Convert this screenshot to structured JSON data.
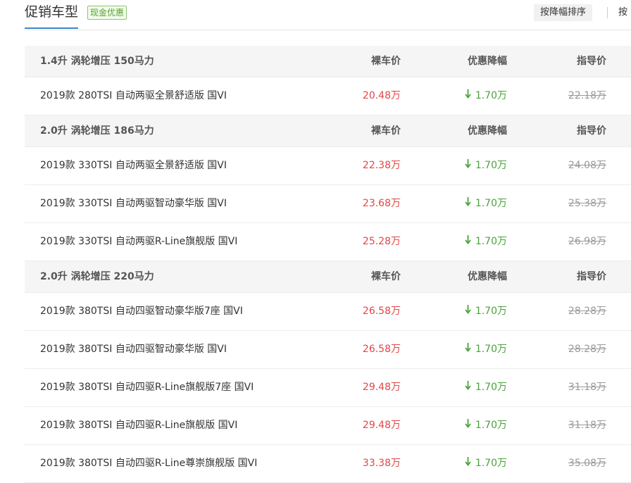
{
  "header": {
    "title": "促销车型",
    "badge": "现金优惠",
    "sort_discount": "按降幅排序",
    "sort_other": "按"
  },
  "columns": {
    "price": "裸车价",
    "discount": "优惠降幅",
    "guide": "指导价"
  },
  "groups": [
    {
      "engine": "1.4升 涡轮增压 150马力",
      "models": [
        {
          "name": "2019款 280TSI 自动两驱全景舒适版 国VI",
          "price": "20.48万",
          "discount": "1.70万",
          "guide": "22.18万"
        }
      ]
    },
    {
      "engine": "2.0升 涡轮增压 186马力",
      "models": [
        {
          "name": "2019款 330TSI 自动两驱全景舒适版 国VI",
          "price": "22.38万",
          "discount": "1.70万",
          "guide": "24.08万"
        },
        {
          "name": "2019款 330TSI 自动两驱智动豪华版 国VI",
          "price": "23.68万",
          "discount": "1.70万",
          "guide": "25.38万"
        },
        {
          "name": "2019款 330TSI 自动两驱R-Line旗舰版 国VI",
          "price": "25.28万",
          "discount": "1.70万",
          "guide": "26.98万"
        }
      ]
    },
    {
      "engine": "2.0升 涡轮增压 220马力",
      "models": [
        {
          "name": "2019款 380TSI 自动四驱智动豪华版7座 国VI",
          "price": "26.58万",
          "discount": "1.70万",
          "guide": "28.28万"
        },
        {
          "name": "2019款 380TSI 自动四驱智动豪华版 国VI",
          "price": "26.58万",
          "discount": "1.70万",
          "guide": "28.28万"
        },
        {
          "name": "2019款 380TSI 自动四驱R-Line旗舰版7座 国VI",
          "price": "29.48万",
          "discount": "1.70万",
          "guide": "31.18万"
        },
        {
          "name": "2019款 380TSI 自动四驱R-Line旗舰版 国VI",
          "price": "29.48万",
          "discount": "1.70万",
          "guide": "31.18万"
        },
        {
          "name": "2019款 380TSI 自动四驱R-Line尊崇旗舰版 国VI",
          "price": "33.38万",
          "discount": "1.70万",
          "guide": "35.08万"
        }
      ]
    }
  ],
  "colors": {
    "accent": "#3e86c9",
    "price": "#e64545",
    "discount": "#4aa33b",
    "badge": "#5aa02c"
  },
  "icons": {
    "discount_arrow": "arrow-down-icon"
  }
}
